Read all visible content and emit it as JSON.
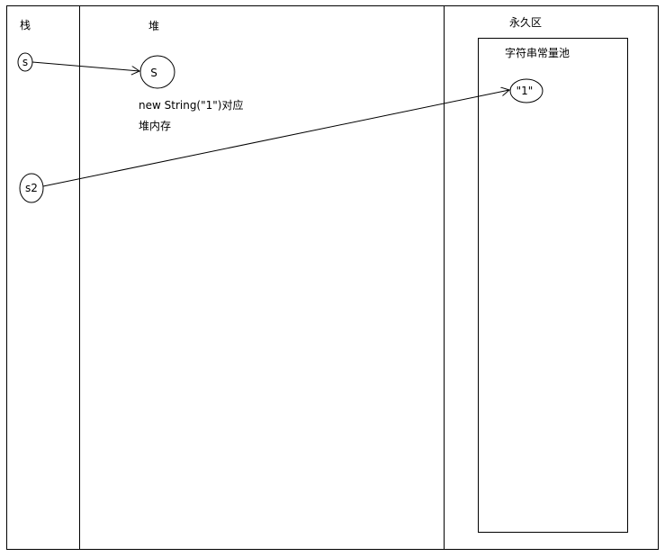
{
  "regions": {
    "stack": "栈",
    "heap": "堆",
    "permgen": "永久区"
  },
  "pool": {
    "title": "字符串常量池"
  },
  "stack_vars": {
    "s": "s",
    "s2": "s2"
  },
  "heap_object": {
    "label": "S",
    "note_line1": "new String(\"1\")对应",
    "note_line2": "堆内存"
  },
  "pool_literal": "\"1\"",
  "colors": {
    "line": "#000000",
    "background": "#ffffff"
  }
}
